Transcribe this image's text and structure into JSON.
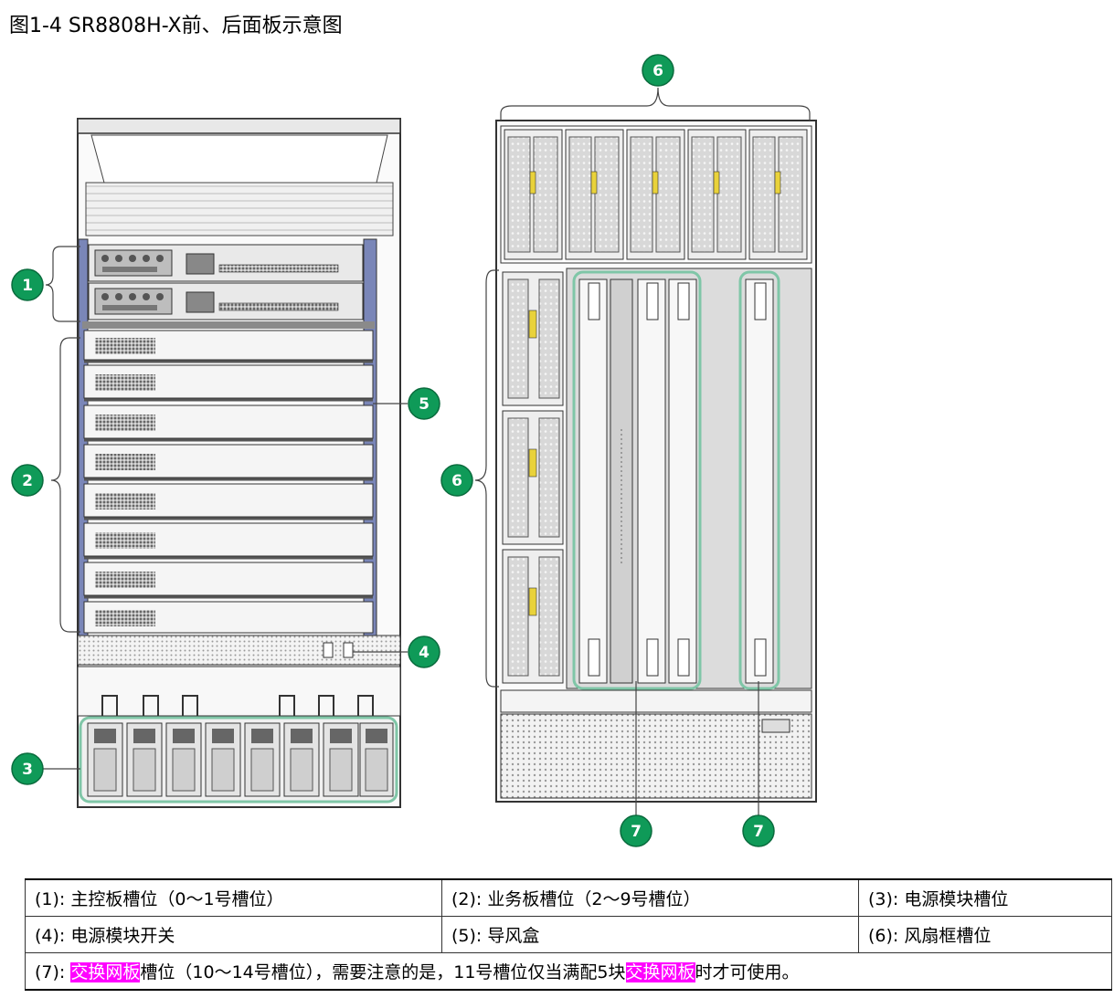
{
  "figure": {
    "title": "图1-4 SR8808H-X前、后面板示意图"
  },
  "callouts": {
    "c1": "1",
    "c2": "2",
    "c3": "3",
    "c4": "4",
    "c5": "5",
    "c6_top": "6",
    "c6_side": "6",
    "c7_left": "7",
    "c7_right": "7"
  },
  "colors": {
    "callout_fill": "#0f9a58",
    "highlight": "#ff00ff",
    "chassis_outline": "#333333"
  },
  "legend": {
    "item1_num": "(1):",
    "item1_text": "主控板槽位（0～1号槽位）",
    "item2_num": "(2):",
    "item2_text": "业务板槽位（2～9号槽位）",
    "item3_num": "(3):",
    "item3_text": "电源模块槽位",
    "item4_num": "(4):",
    "item4_text": "电源模块开关",
    "item5_num": "(5):",
    "item5_text": "导风盒",
    "item6_num": "(6):",
    "item6_text": "风扇框槽位",
    "item7_num": "(7):",
    "item7_hl1": "交换网板",
    "item7_mid": "槽位（10～14号槽位），需要注意的是，11号槽位仅当满配5块",
    "item7_hl2": "交换网板",
    "item7_end": "时才可使用。"
  }
}
